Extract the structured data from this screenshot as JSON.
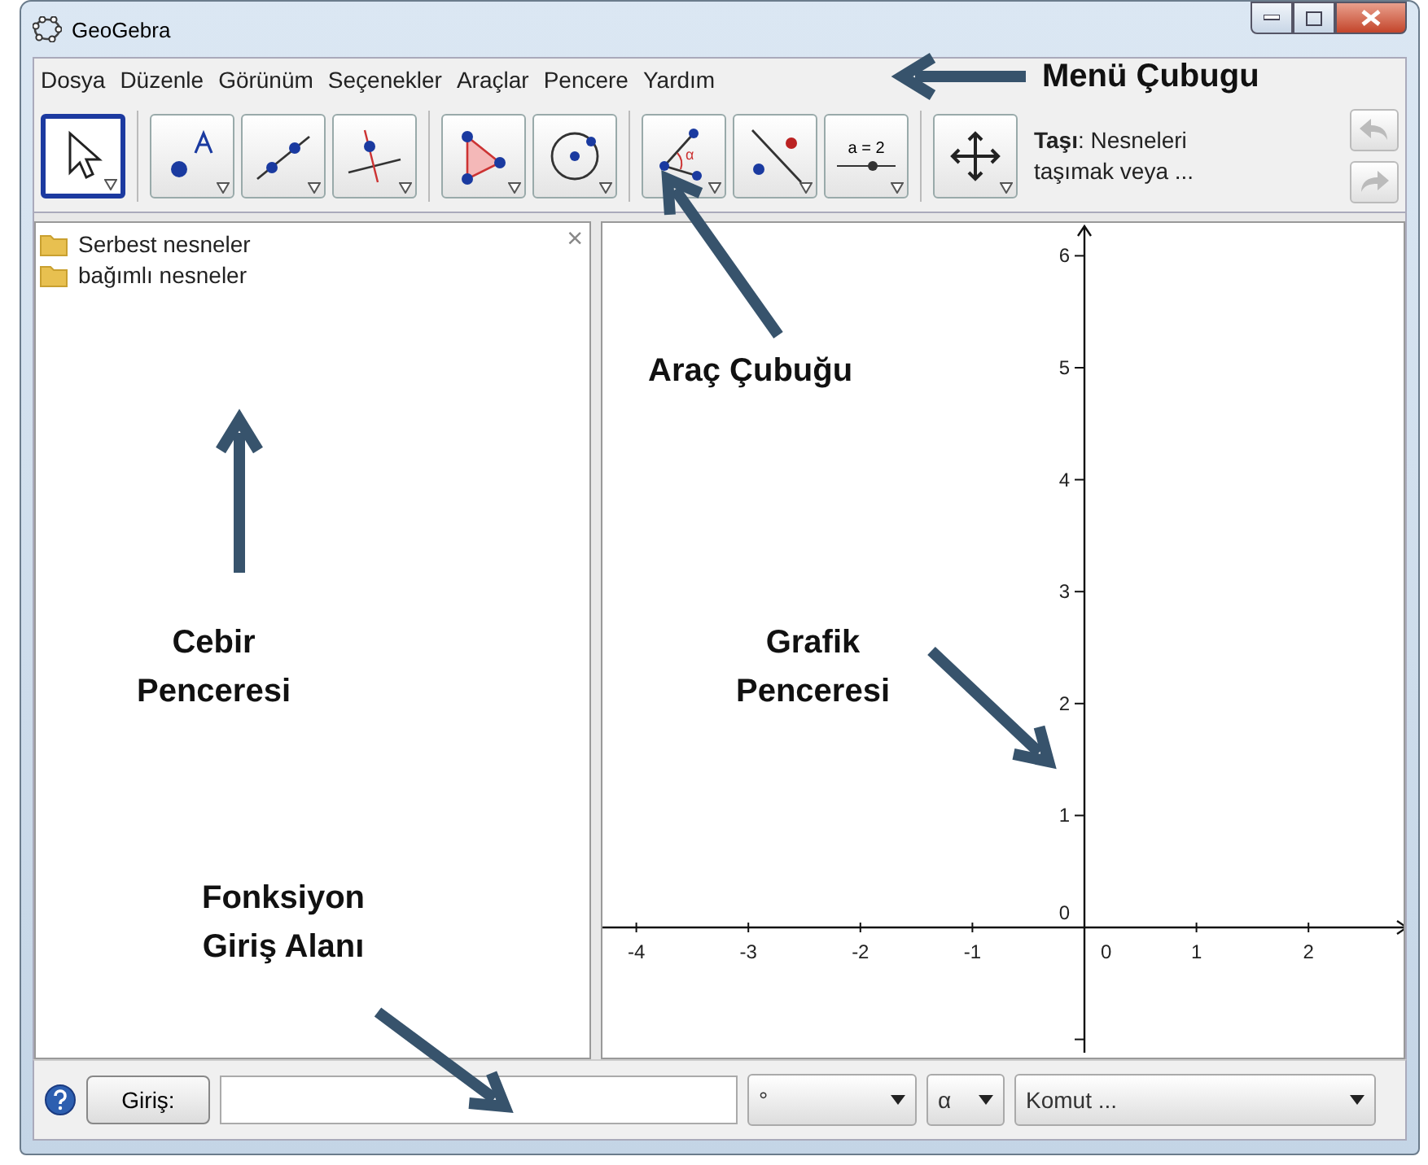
{
  "window": {
    "title": "GeoGebra"
  },
  "menu": [
    "Dosya",
    "Düzenle",
    "Görünüm",
    "Seçenekler",
    "Araçlar",
    "Pencere",
    "Yardım"
  ],
  "toolbar": {
    "tool_groups": [
      [
        {
          "kind": "move",
          "selected": true
        }
      ],
      [
        {
          "kind": "point",
          "selected": false
        },
        {
          "kind": "line",
          "selected": false
        },
        {
          "kind": "perpendicular",
          "selected": false
        }
      ],
      [
        {
          "kind": "polygon",
          "selected": false
        },
        {
          "kind": "circle",
          "selected": false
        }
      ],
      [
        {
          "kind": "angle",
          "selected": false,
          "glyph": "α"
        },
        {
          "kind": "reflect",
          "selected": false
        },
        {
          "kind": "slider",
          "selected": false,
          "label": "a = 2"
        }
      ],
      [
        {
          "kind": "pan",
          "selected": false
        }
      ]
    ],
    "help": "**Taşı**: Nesneleri taşımak veya ..."
  },
  "algebra_view": {
    "items": [
      "Serbest nesneler",
      "bağımlı nesneler"
    ],
    "close": "×"
  },
  "graphics_view": {
    "x_labels": [
      "-4",
      "-3",
      "-2",
      "-1",
      "0",
      "1",
      "2"
    ],
    "y_labels": [
      "6",
      "5",
      "4",
      "3",
      "2",
      "1",
      "0"
    ]
  },
  "input_bar": {
    "button": "Giriş:",
    "symbols": "°",
    "greek": "α",
    "command": "Komut ..."
  },
  "annotations": [
    {
      "lines": [
        "Menü Çubugu"
      ]
    },
    {
      "lines": [
        "Araç Çubuğu"
      ]
    },
    {
      "lines": [
        "Cebir",
        "Penceresi"
      ]
    },
    {
      "lines": [
        "Grafik",
        "Penceresi"
      ]
    },
    {
      "lines": [
        "Fonksiyon",
        "Giriş Alanı"
      ]
    }
  ]
}
